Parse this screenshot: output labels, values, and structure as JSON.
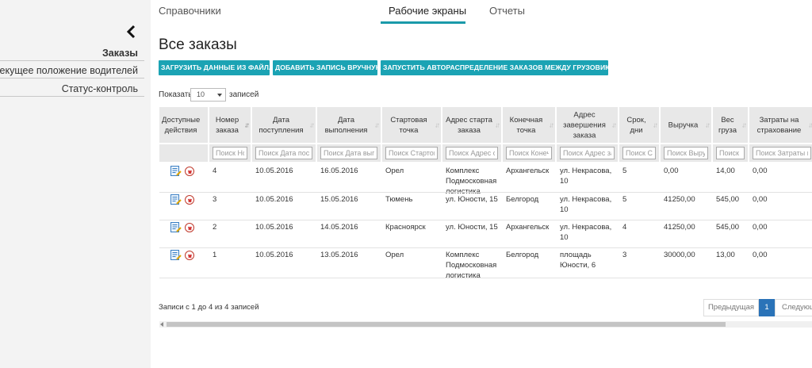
{
  "topnav": {
    "tabs": [
      "Справочники",
      "Рабочие экраны",
      "Отчеты"
    ]
  },
  "sidebar": {
    "items": [
      "Заказы",
      "Текущее положение водителей",
      "Статус-контроль"
    ]
  },
  "main": {
    "title": "Все заказы",
    "buttons": [
      "ЗАГРУЗИТЬ ДАННЫЕ ИЗ ФАЙЛА",
      "ДОБАВИТЬ ЗАПИСЬ ВРУЧНУЮ",
      "ЗАПУСТИТЬ АВТОРАСПРЕДЕЛЕНИЕ ЗАКАЗОВ МЕЖДУ ГРУЗОВИКАМИ"
    ],
    "length": {
      "prefix": "Показать",
      "value": "10",
      "suffix": "записей"
    }
  },
  "table": {
    "headers": [
      "Доступные действия",
      "Номер заказа",
      "Дата поступления",
      "Дата выполнения",
      "Стартовая точка",
      "Адрес старта заказа",
      "Конечная точка",
      "Адрес завершения заказа",
      "Срок, дни",
      "Выручка",
      "Вес груза",
      "Затраты на страхование"
    ],
    "filters": [
      "",
      "Поиск Номер заказа",
      "Поиск Дата поступления",
      "Поиск Дата выполнения",
      "Поиск Стартовая точка",
      "Поиск Адрес старта заказа",
      "Поиск Конечная точка",
      "Поиск Адрес завершения заказа",
      "Поиск Срок, дни",
      "Поиск Выручка",
      "Поиск Вес груза",
      "Поиск Затраты на страхование"
    ],
    "rows": [
      [
        "4",
        "10.05.2016",
        "16.05.2016",
        "Орел",
        "Комплекс Подмосковная логистика",
        "Архангельск",
        "ул. Некрасова, 10",
        "5",
        "0,00",
        "14,00",
        "0,00"
      ],
      [
        "3",
        "10.05.2016",
        "15.05.2016",
        "Тюмень",
        "ул. Юности, 15",
        "Белгород",
        "ул. Некрасова, 10",
        "5",
        "41250,00",
        "545,00",
        "0,00"
      ],
      [
        "2",
        "10.05.2016",
        "14.05.2016",
        "Красноярск",
        "ул. Юности, 15",
        "Архангельск",
        "ул. Некрасова, 10",
        "4",
        "41250,00",
        "545,00",
        "0,00"
      ],
      [
        "1",
        "10.05.2016",
        "13.05.2016",
        "Орел",
        "Комплекс Подмосковная логистика",
        "Белгород",
        "площадь Юности, 6",
        "3",
        "30000,00",
        "13,00",
        "0,00"
      ]
    ]
  },
  "footer": {
    "info": "Записи с 1 до 4 из 4 записей",
    "prev": "Предыдущая",
    "page": "1",
    "next": "Следующая"
  },
  "colors": {
    "accent": "#1ba3b4",
    "active_page": "#2a73b8",
    "header_bg": "#e8e8e8"
  },
  "icons": {
    "collapse": "chevron-left-icon",
    "edit": "edit-icon",
    "delete": "delete-icon"
  }
}
